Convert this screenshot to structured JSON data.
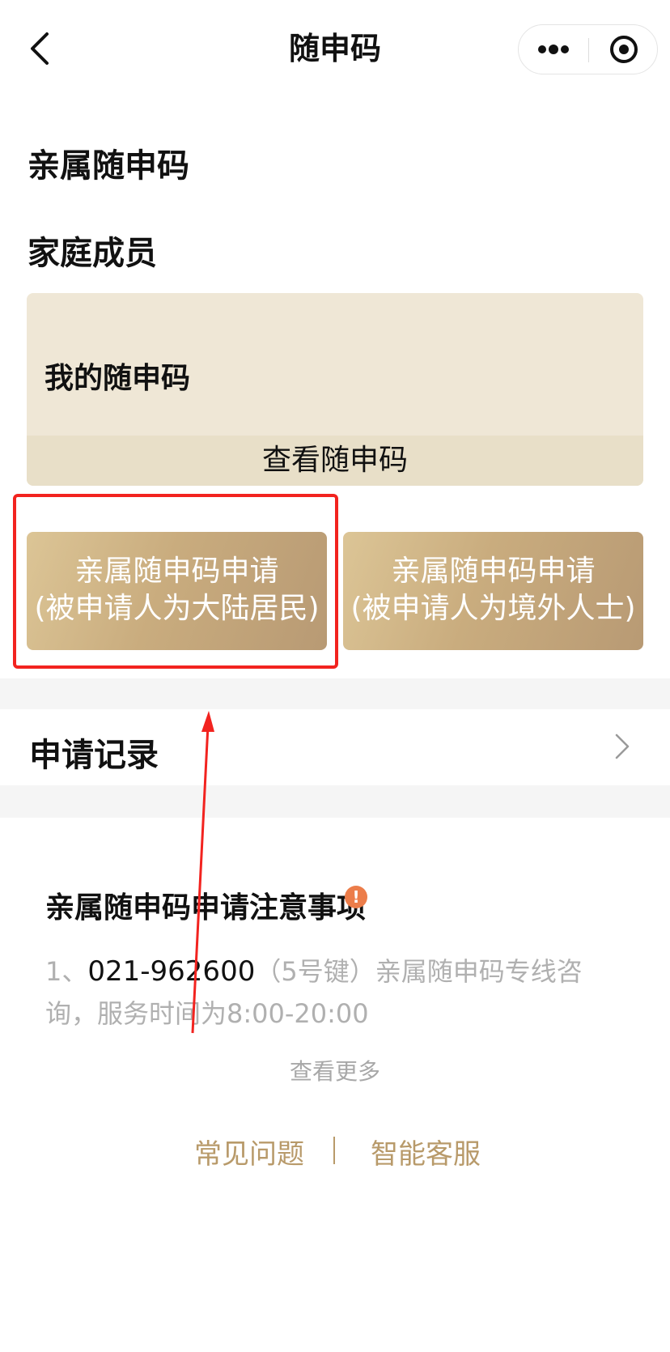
{
  "nav": {
    "title": "随申码",
    "back_icon": "chevron-left-icon",
    "more_icon": "more-dots-icon",
    "target_icon": "target-icon"
  },
  "main": {
    "title": "亲属随申码",
    "family_heading": "家庭成员",
    "my_code_label": "我的随申码",
    "view_code_button": "查看随申码",
    "apply_mainland": {
      "line1": "亲属随申码申请",
      "line2": "(被申请人为大陆居民)"
    },
    "apply_overseas": {
      "line1": "亲属随申码申请",
      "line2": "(被申请人为境外人士)"
    },
    "highlight_color": "#f2231f"
  },
  "records": {
    "label": "申请记录",
    "chevron_icon": "chevron-right-icon"
  },
  "notice": {
    "title": "亲属随申码申请注意事项",
    "badge": "!",
    "item_prefix": "1、",
    "item_phone": "021-962600",
    "item_rest": "（5号键）亲属随申码专线咨询，服务时间为8:00-20:00",
    "see_more": "查看更多"
  },
  "footer": {
    "faq": "常见问题",
    "service": "智能客服"
  },
  "colors": {
    "gold_gradient_start": "#dcc596",
    "gold_gradient_end": "#b89a74",
    "footer_link": "#b89a6a",
    "card_bg": "#efe7d6"
  }
}
